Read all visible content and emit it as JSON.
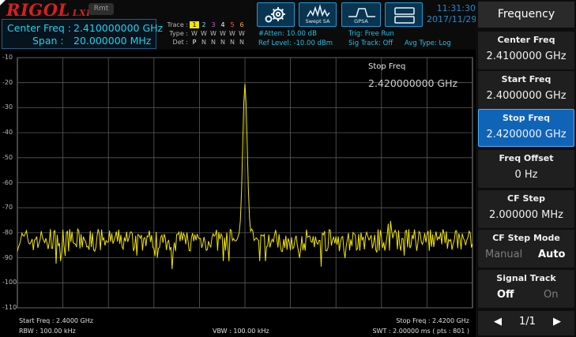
{
  "header": {
    "brand": "RIGOL",
    "brand_suffix": "LXI",
    "remote_badge": "Rmt",
    "center_freq_label": "Center Freq :",
    "center_freq_value": "2.410000000 GHz",
    "span_label": "Span :",
    "span_value": "20.000000 MHz",
    "trace": {
      "trace_label": "Trace :",
      "type_label": "Type :",
      "det_label": "Det :",
      "numbers": [
        "1",
        "2",
        "3",
        "4",
        "5",
        "6"
      ],
      "number_colors": [
        "#f2e600",
        "#7fd6ff",
        "#d05ad0",
        "#ffffff",
        "#ff6060",
        "#ffae3a"
      ],
      "types": [
        "W",
        "W",
        "W",
        "W",
        "W",
        "W"
      ],
      "dets": [
        "P",
        "N",
        "N",
        "N",
        "N",
        "N"
      ]
    },
    "atten": "#Atten: 10.00 dB",
    "ref_level": "Ref Level: -10.00 dBm",
    "trig": "Trig: Free Run",
    "sig_track": "Sig Track: Off",
    "avg_type": "Avg Type: Log",
    "tools": [
      {
        "name": "settings",
        "icon": "gear-icon",
        "caption": ""
      },
      {
        "name": "swept-sa",
        "icon": "spectrum-icon",
        "caption": "Swept SA"
      },
      {
        "name": "gpsa",
        "icon": "gpsa-icon",
        "caption": "GPSA"
      },
      {
        "name": "layout",
        "icon": "window-layout-icon",
        "caption": ""
      }
    ],
    "time": "11:31:30",
    "date": "2017/11/29"
  },
  "graticule": {
    "y_ticks": [
      "-10",
      "-20",
      "-30",
      "-40",
      "-50",
      "-60",
      "-70",
      "-80",
      "-90",
      "-100",
      "-110"
    ],
    "marker_title": "Stop Freq",
    "marker_value": "2.420000000 GHz",
    "trace_color": "#f2e600"
  },
  "chart_data": {
    "type": "line",
    "x_start_ghz": 2.4,
    "x_stop_ghz": 2.42,
    "ylim": [
      -110,
      -10
    ],
    "y_unit": "dBm",
    "peak_x_ghz": 2.41,
    "peak_y": -21,
    "noise_floor_y": -83
  },
  "footer": {
    "start_freq": "Start Freq : 2.4000 GHz",
    "stop_freq": "Stop Freq : 2.4200 GHz",
    "rbw": "RBW : 100.00 kHz",
    "vbw": "VBW : 100.00 kHz",
    "swt": "SWT : 2.00000 ms ( pts : 801 )"
  },
  "menu": {
    "title": "Frequency",
    "softkeys": [
      {
        "label": "Center Freq",
        "value": "2.4100000 GHz"
      },
      {
        "label": "Start Freq",
        "value": "2.4000000 GHz"
      },
      {
        "label": "Stop Freq",
        "value": "2.4200000 GHz"
      },
      {
        "label": "Freq Offset",
        "value": "0 Hz"
      },
      {
        "label": "CF Step",
        "value": "2.000000 MHz"
      },
      {
        "label": "CF Step Mode",
        "opt_a": "Manual",
        "opt_b": "Auto"
      },
      {
        "label": "Signal Track",
        "opt_a": "Off",
        "opt_b": "On"
      }
    ],
    "page": "1/1"
  }
}
